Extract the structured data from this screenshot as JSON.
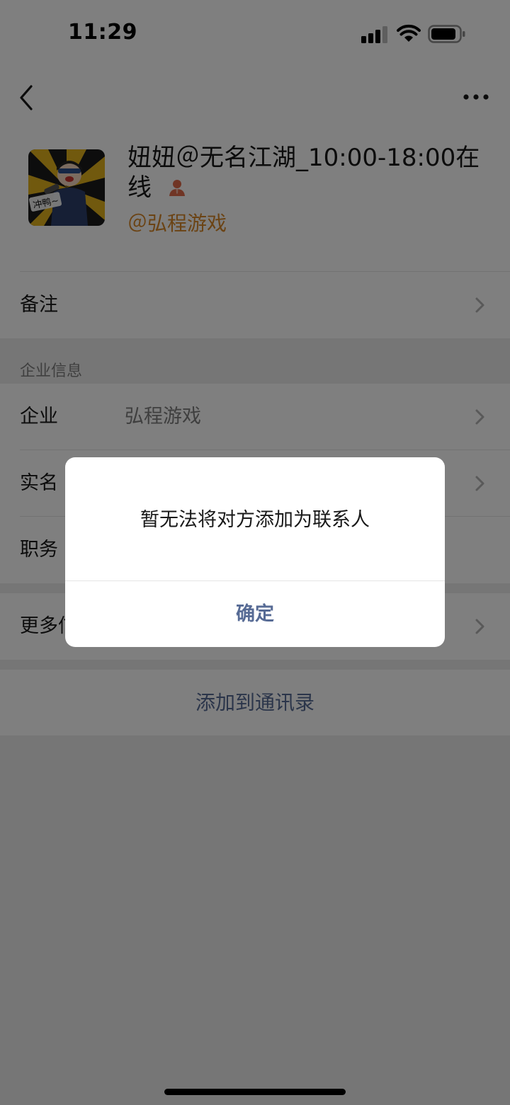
{
  "status_bar": {
    "time": "11:29"
  },
  "nav": {
    "back_icon": "chevron-left-icon",
    "more_icon": "ellipsis-icon"
  },
  "profile": {
    "name": "妞妞＠无名江湖_10:00-18:00在线",
    "company_tag": "＠弘程游戏",
    "avatar_caption": "冲鸭~",
    "person_icon_color": "#e06a4a",
    "company_color": "#d68728"
  },
  "rows": {
    "remark_label": "备注",
    "section_title": "企业信息",
    "enterprise_label": "企业",
    "enterprise_value": "弘程游戏",
    "realname_label": "实名",
    "position_label": "职务",
    "more_label": "更多信息"
  },
  "actions": {
    "add_contact": "添加到通讯录",
    "link_color": "#576b95"
  },
  "dialog": {
    "message": "暂无法将对方添加为联系人",
    "confirm": "确定"
  }
}
